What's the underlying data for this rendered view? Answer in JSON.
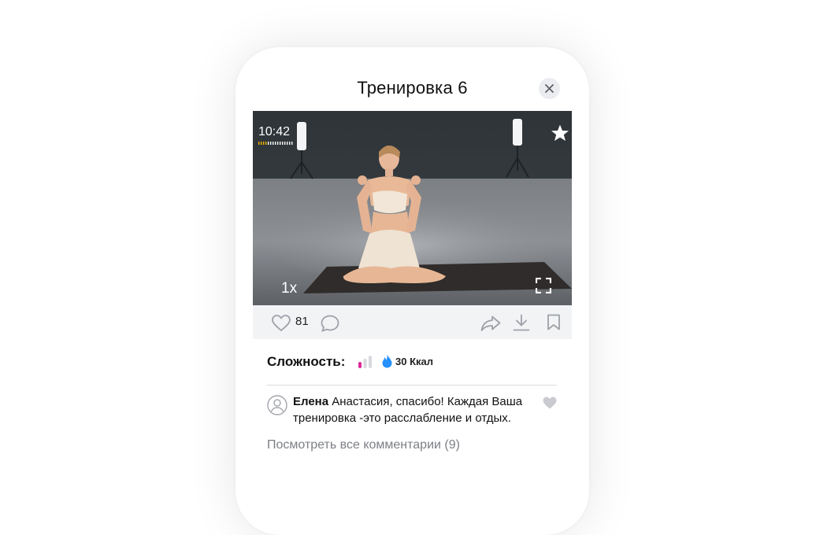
{
  "header": {
    "title": "Тренировка 6"
  },
  "video": {
    "duration": "10:42",
    "speed": "1x"
  },
  "actions": {
    "likes_count": "81"
  },
  "info": {
    "difficulty_label": "Сложность:",
    "calories": "30 Ккал"
  },
  "comment": {
    "author": "Елена",
    "text": " Анастасия, спасибо! Каждая Ваша тренировка -это  расслабление и отдых."
  },
  "view_all_comments": "Посмотреть все комментарии (9)",
  "colors": {
    "accent_pink": "#e0269b",
    "difficulty_inactive": "#d8d9de",
    "kcal_drop": "#2491ff",
    "progress_dots": "#f2b705"
  }
}
